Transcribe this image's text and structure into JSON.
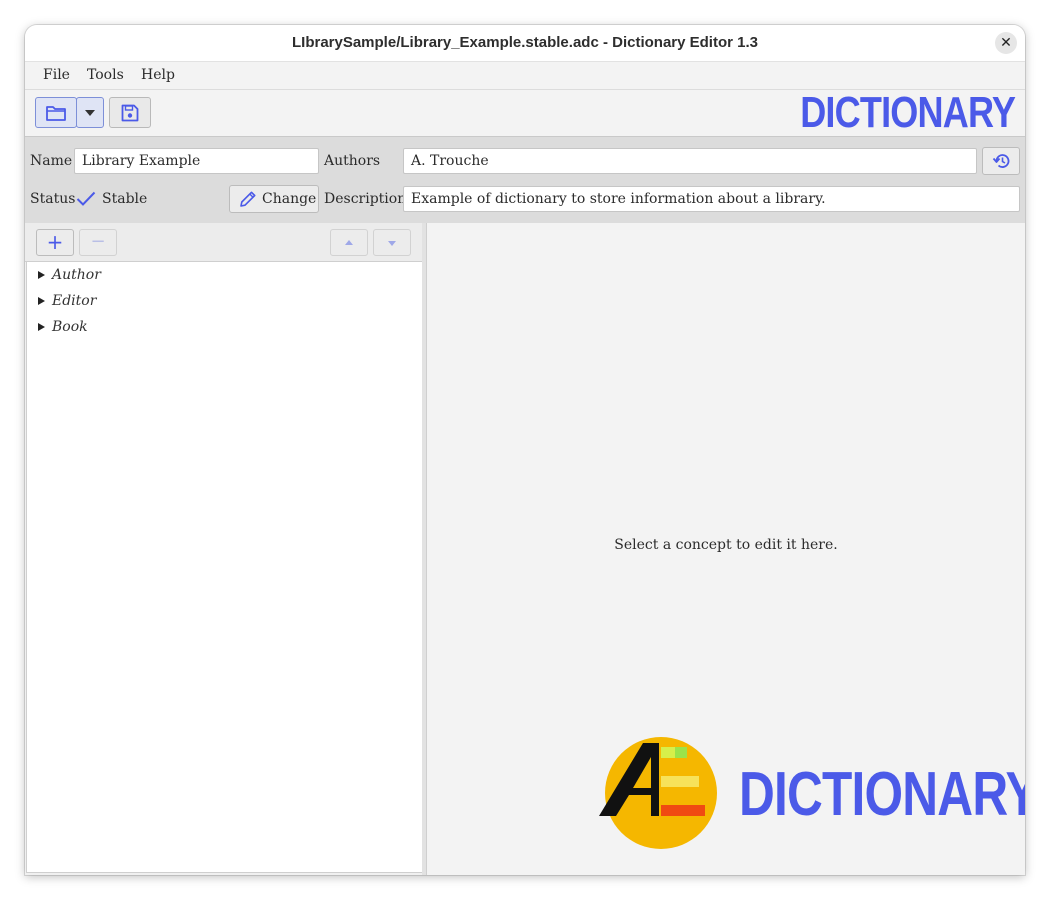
{
  "window": {
    "title": "LIbrarySample/Library_Example.stable.adc - Dictionary Editor 1.3",
    "close_symbol": "✕"
  },
  "menu": [
    {
      "label": "File"
    },
    {
      "label": "Tools"
    },
    {
      "label": "Help"
    }
  ],
  "toolbar": {
    "open_icon": "folder-icon",
    "dropdown_icon": "chevron-down-icon",
    "save_icon": "save-icon",
    "brand_text": "DICTIONARY"
  },
  "properties": {
    "name_label": "Name",
    "name_value": "Library Example",
    "authors_label": "Authors",
    "authors_value": "A. Trouche",
    "history_icon": "history-icon",
    "status_label": "Status",
    "status_value": "Stable",
    "status_icon": "checkmark-icon",
    "change_label": "Change",
    "change_icon": "pencil-icon",
    "description_label": "Description",
    "description_value": "Example of dictionary to store information about a library."
  },
  "left_toolbar": {
    "add_symbol": "+",
    "remove_symbol": "−",
    "up_icon": "arrow-up-icon",
    "down_icon": "arrow-down-icon"
  },
  "tree": [
    {
      "label": "Author"
    },
    {
      "label": "Editor"
    },
    {
      "label": "Book"
    }
  ],
  "editor": {
    "placeholder": "Select a concept to edit it here.",
    "logo_text": "DICTIONARY",
    "logo_letters": "AE"
  },
  "colors": {
    "accent": "#4b5ae8",
    "logo_circle": "#f5b700",
    "logo_green": "#9be34a",
    "logo_yellow": "#f7e25a",
    "logo_red": "#f04a12"
  }
}
